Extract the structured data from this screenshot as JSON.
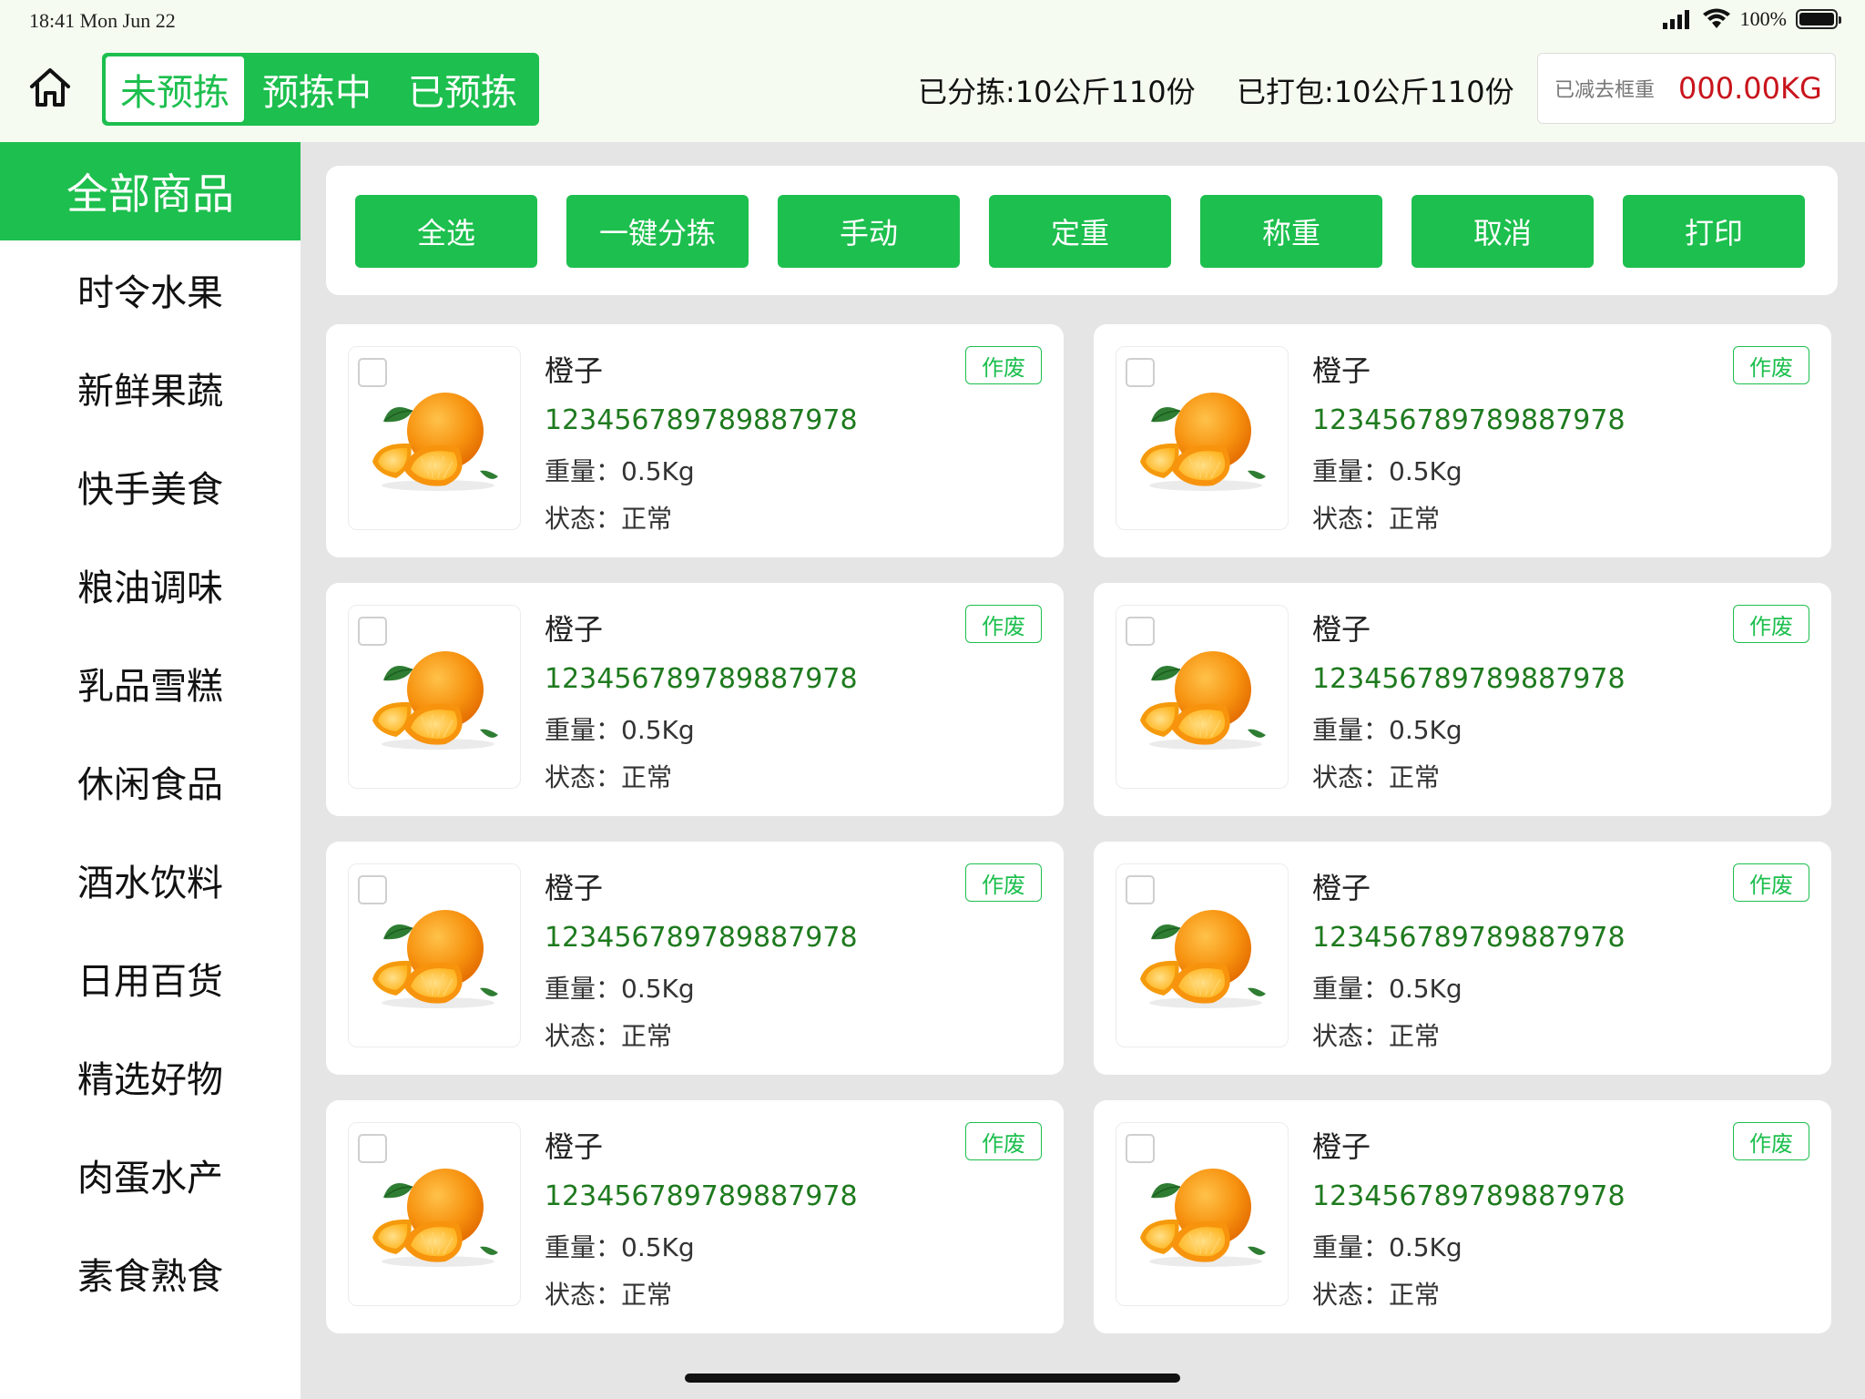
{
  "status_bar": {
    "time": "18:41 Mon Jun 22",
    "battery": "100%"
  },
  "header": {
    "tabs": [
      "未预拣",
      "预拣中",
      "已预拣"
    ],
    "active_tab": 0,
    "sorted_stat": "已分拣:10公斤110份",
    "packed_stat": "已打包:10公斤110份",
    "tare_label": "已减去框重",
    "tare_value": "000.00KG"
  },
  "sidebar": {
    "items": [
      "全部商品",
      "时令水果",
      "新鲜果蔬",
      "快手美食",
      "粮油调味",
      "乳品雪糕",
      "休闲食品",
      "酒水饮料",
      "日用百货",
      "精选好物",
      "肉蛋水产",
      "素食熟食"
    ],
    "active_index": 0
  },
  "toolbar": {
    "buttons": [
      "全选",
      "一键分拣",
      "手动",
      "定重",
      "称重",
      "取消",
      "打印"
    ]
  },
  "products": [
    {
      "name": "橙子",
      "code": "123456789789887978",
      "weight": "重量：0.5Kg",
      "state": "状态：正常",
      "void_label": "作废",
      "checked": false
    },
    {
      "name": "橙子",
      "code": "123456789789887978",
      "weight": "重量：0.5Kg",
      "state": "状态：正常",
      "void_label": "作废",
      "checked": false
    },
    {
      "name": "橙子",
      "code": "123456789789887978",
      "weight": "重量：0.5Kg",
      "state": "状态：正常",
      "void_label": "作废",
      "checked": false
    },
    {
      "name": "橙子",
      "code": "123456789789887978",
      "weight": "重量：0.5Kg",
      "state": "状态：正常",
      "void_label": "作废",
      "checked": false
    },
    {
      "name": "橙子",
      "code": "123456789789887978",
      "weight": "重量：0.5Kg",
      "state": "状态：正常",
      "void_label": "作废",
      "checked": false
    },
    {
      "name": "橙子",
      "code": "123456789789887978",
      "weight": "重量：0.5Kg",
      "state": "状态：正常",
      "void_label": "作废",
      "checked": false
    },
    {
      "name": "橙子",
      "code": "123456789789887978",
      "weight": "重量：0.5Kg",
      "state": "状态：正常",
      "void_label": "作废",
      "checked": false
    },
    {
      "name": "橙子",
      "code": "123456789789887978",
      "weight": "重量：0.5Kg",
      "state": "状态：正常",
      "void_label": "作废",
      "checked": false
    }
  ],
  "colors": {
    "brand_green": "#1dbf4e",
    "code_green": "#1e7a1e",
    "tare_red": "#c9141c",
    "header_bg": "#f5fbf0",
    "page_bg": "#e5e5e5"
  },
  "icons": {
    "home": "home-icon",
    "signal": "cellular-signal-icon",
    "wifi": "wifi-icon",
    "battery": "battery-icon",
    "product_image": "orange-image"
  }
}
